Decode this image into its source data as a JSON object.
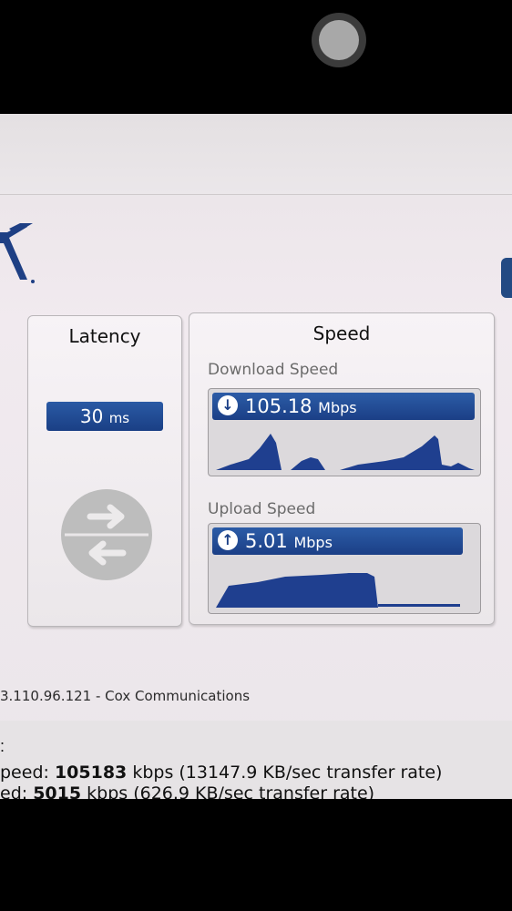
{
  "header": {
    "blurred_title": ""
  },
  "latency": {
    "title": "Latency",
    "value": "30",
    "unit": "ms"
  },
  "speed": {
    "title": "Speed",
    "download": {
      "label": "Download Speed",
      "value": "105.18",
      "unit": "Mbps",
      "icon": "down-arrow-icon"
    },
    "upload": {
      "label": "Upload Speed",
      "value": "5.01",
      "unit": "Mbps",
      "icon": "up-arrow-icon"
    }
  },
  "connection": {
    "ip_provider": "3.110.96.121 - Cox Communications"
  },
  "results": {
    "colon": ":",
    "download_prefix": "peed: ",
    "download_kbps": "105183",
    "download_suffix": " kbps (13147.9 KB/sec transfer rate)",
    "upload_prefix": "ed: ",
    "upload_kbps": "5015",
    "upload_suffix": " kbps (626.9 KB/sec transfer rate)"
  },
  "colors": {
    "accent": "#1b3f86",
    "graph_fill": "#1f3f8f",
    "icon_gray": "#bdbdbd"
  }
}
